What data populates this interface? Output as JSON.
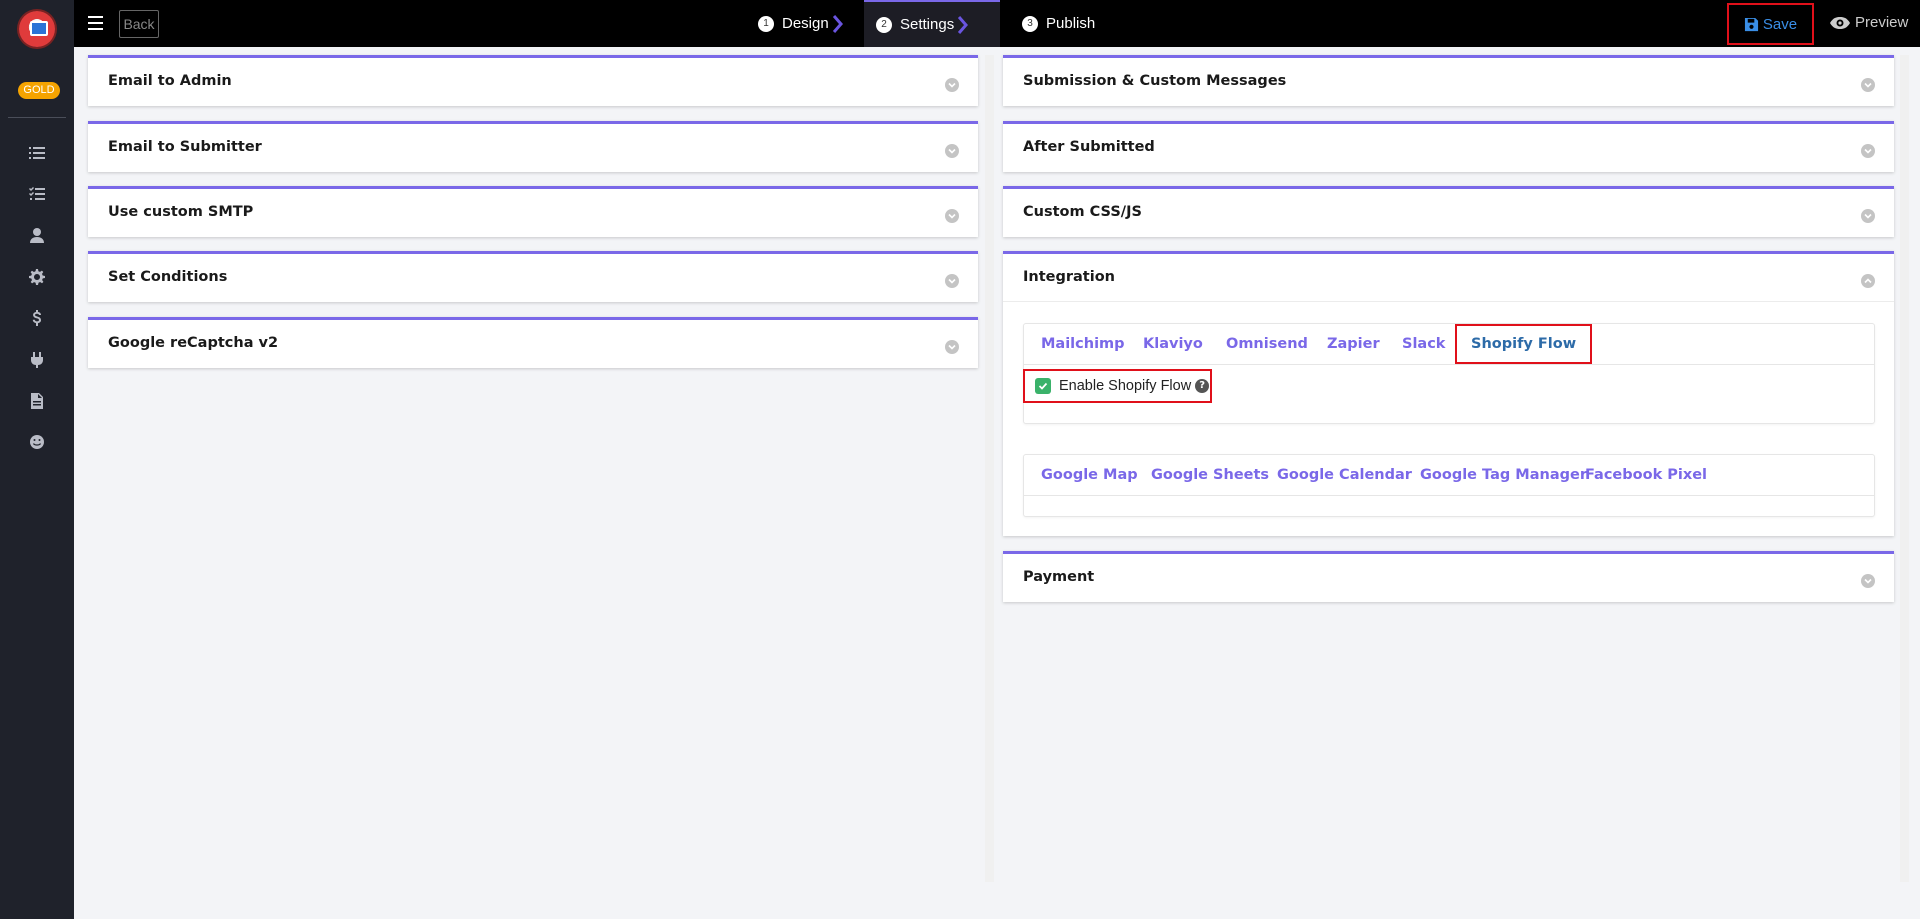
{
  "sidebar": {
    "badge": "GOLD",
    "icons": [
      "list-icon",
      "checklist-icon",
      "user-icon",
      "gear-icon",
      "dollar-icon",
      "plug-icon",
      "document-icon",
      "smiley-icon"
    ]
  },
  "topbar": {
    "back_label": "Back",
    "steps": [
      {
        "num": "1",
        "label": "Design"
      },
      {
        "num": "2",
        "label": "Settings"
      },
      {
        "num": "3",
        "label": "Publish"
      }
    ],
    "active_step": "Settings",
    "save_label": "Save",
    "preview_label": "Preview"
  },
  "left_panels": [
    {
      "title": "Email to Admin"
    },
    {
      "title": "Email to Submitter"
    },
    {
      "title": "Use custom SMTP"
    },
    {
      "title": "Set Conditions"
    },
    {
      "title": "Google reCaptcha v2"
    }
  ],
  "right_panels": [
    {
      "title": "Submission & Custom Messages"
    },
    {
      "title": "After Submitted"
    },
    {
      "title": "Custom CSS/JS"
    },
    {
      "title": "Integration"
    },
    {
      "title": "Payment"
    }
  ],
  "integration": {
    "tabs_row1": [
      "Mailchimp",
      "Klaviyo",
      "Omnisend",
      "Zapier",
      "Slack",
      "Shopify Flow"
    ],
    "active_tab": "Shopify Flow",
    "enable_label": "Enable Shopify Flow",
    "enable_checked": true,
    "help_glyph": "?",
    "tabs_row2": [
      "Google Map",
      "Google Sheets",
      "Google Calendar",
      "Google Tag Manager",
      "Facebook Pixel"
    ]
  },
  "colors": {
    "accent": "#7a68e8",
    "highlight": "#e0101a",
    "save": "#3a8ee6",
    "checkbox": "#3ab26a",
    "badge": "#f5a300"
  }
}
